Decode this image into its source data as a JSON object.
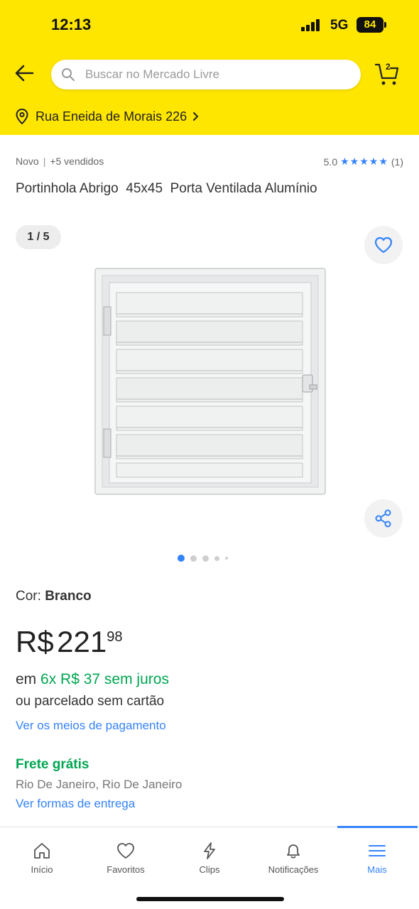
{
  "status_bar": {
    "time": "12:13",
    "network": "5G",
    "battery": "84"
  },
  "header": {
    "search_placeholder": "Buscar no Mercado Livre",
    "cart_count": "2",
    "address": "Rua Eneida de Morais 226",
    "brand_color": "#ffe600"
  },
  "product": {
    "condition": "Novo",
    "sold": "+5 vendidos",
    "rating": "5.0",
    "review_count": "(1)",
    "title": "Portinhola Abrigo  45x45  Porta Ventilada Alumínio",
    "gallery_counter": "1 / 5",
    "gallery_total": 5,
    "gallery_current": 1,
    "color_label": "Cor:",
    "color_value": "Branco",
    "price_currency": "R$",
    "price_integer": "221",
    "price_cents": "98",
    "installment_prefix": "em",
    "installment_value": "6x R$ 37 sem juros",
    "no_card_text": "ou parcelado sem cartão",
    "payment_link": "Ver os meios de pagamento",
    "shipping_title": "Frete grátis",
    "shipping_city": "Rio De Janeiro, Rio De Janeiro",
    "shipping_link": "Ver formas de entrega"
  },
  "tabbar": {
    "tabs": [
      {
        "label": "Início",
        "icon": "home-icon"
      },
      {
        "label": "Favoritos",
        "icon": "heart-icon"
      },
      {
        "label": "Clips",
        "icon": "lightning-icon"
      },
      {
        "label": "Notificações",
        "icon": "bell-icon"
      },
      {
        "label": "Mais",
        "icon": "menu-icon"
      }
    ],
    "active_index": 4
  },
  "colors": {
    "accent": "#3483fa",
    "success": "#00a650",
    "header_bg": "#ffe600"
  }
}
